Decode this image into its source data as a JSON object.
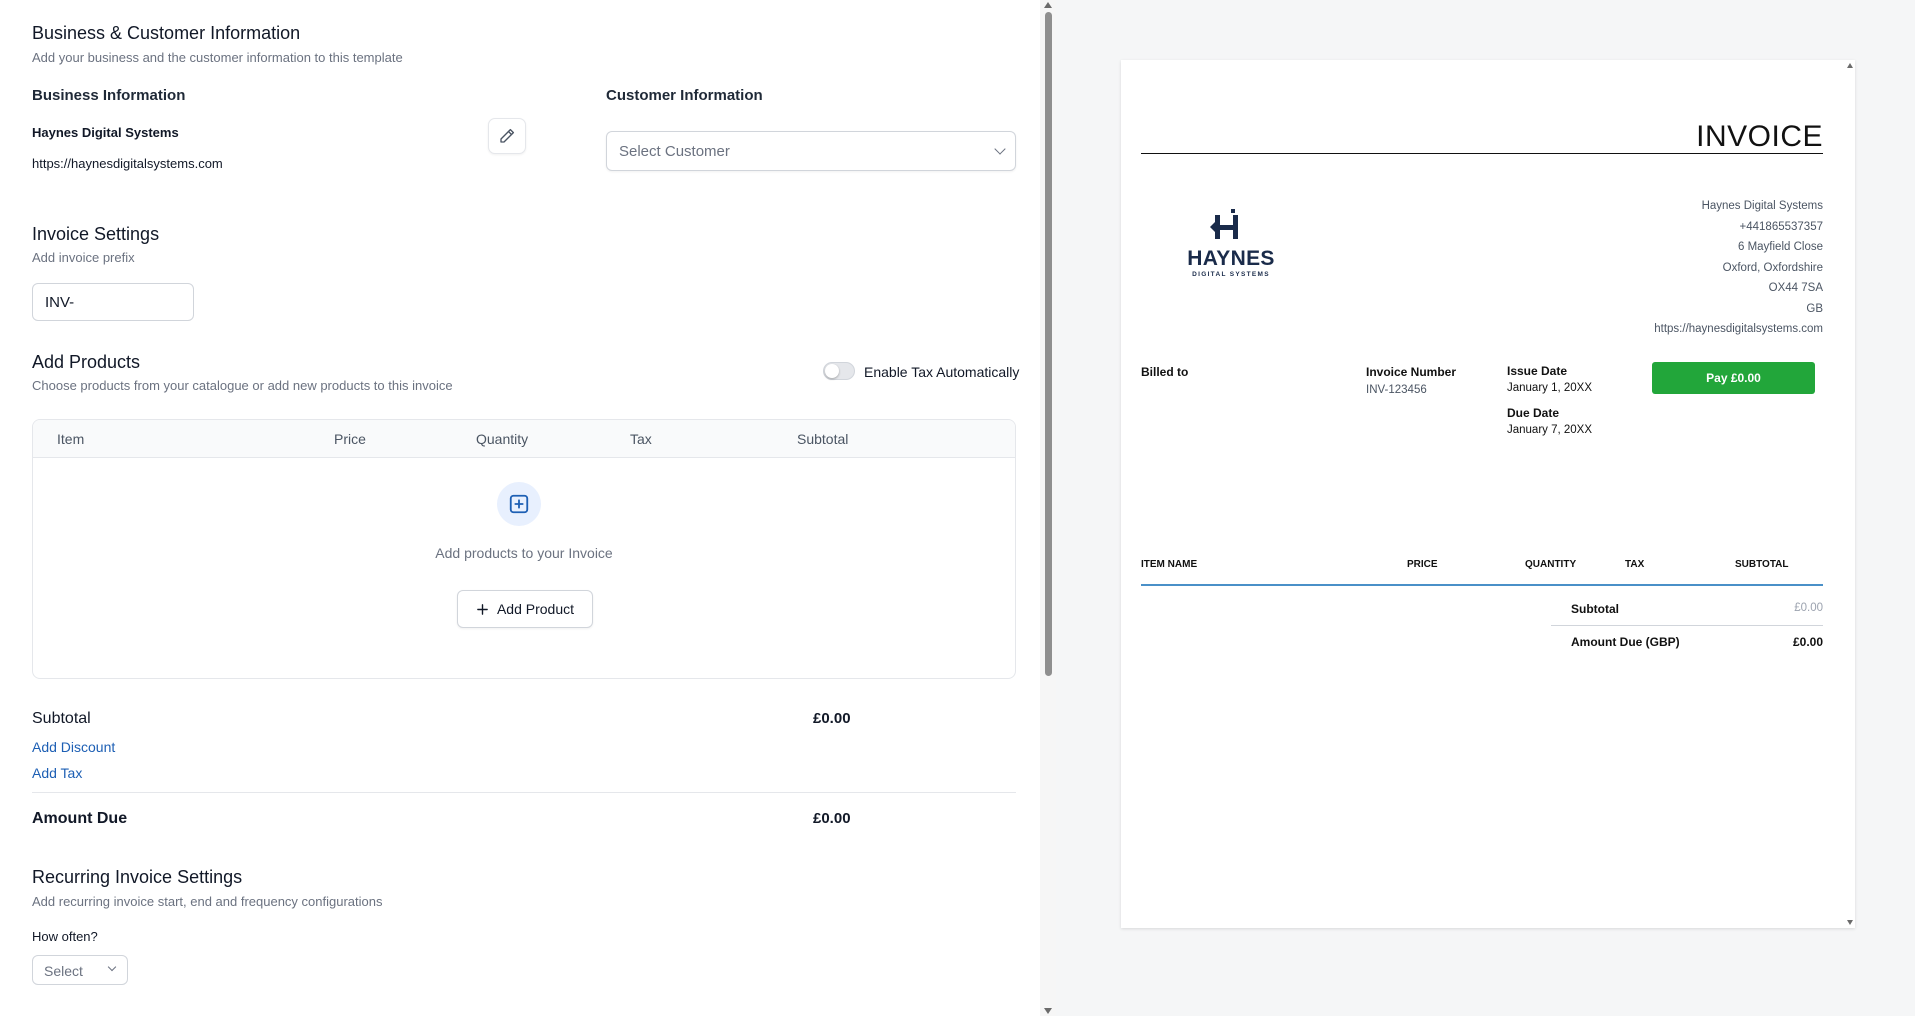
{
  "business_customer": {
    "title": "Business & Customer Information",
    "subtitle": "Add your business and the customer information to this template",
    "business_heading": "Business Information",
    "business_name": "Haynes Digital Systems",
    "business_url": "https://haynesdigitalsystems.com",
    "customer_heading": "Customer Information",
    "customer_select_placeholder": "Select Customer"
  },
  "invoice_settings": {
    "title": "Invoice Settings",
    "subtitle": "Add invoice prefix",
    "prefix_value": "INV-"
  },
  "add_products": {
    "title": "Add Products",
    "subtitle": "Choose products from your catalogue or add new products to this invoice",
    "tax_toggle_label": "Enable Tax Automatically",
    "tax_toggle_on": false,
    "columns": [
      "Item",
      "Price",
      "Quantity",
      "Tax",
      "Subtotal"
    ],
    "empty_text": "Add products to your Invoice",
    "add_button_label": "Add Product"
  },
  "totals": {
    "subtotal_label": "Subtotal",
    "subtotal_value": "£0.00",
    "add_discount_label": "Add Discount",
    "add_tax_label": "Add Tax",
    "amount_due_label": "Amount Due",
    "amount_due_value": "£0.00"
  },
  "recurring": {
    "title": "Recurring Invoice Settings",
    "subtitle": "Add recurring invoice start, end and frequency configurations",
    "how_often_label": "How often?",
    "frequency_placeholder": "Select"
  },
  "preview": {
    "title": "INVOICE",
    "logo_text": "HAYNES",
    "logo_subtext": "DIGITAL SYSTEMS",
    "from": {
      "name": "Haynes Digital Systems",
      "phone": "+441865537357",
      "street": "6 Mayfield Close",
      "city": "Oxford, Oxfordshire",
      "postcode": "OX44 7SA",
      "country": "GB",
      "url": "https://haynesdigitalsystems.com"
    },
    "billed_to_label": "Billed to",
    "invoice_number_label": "Invoice Number",
    "invoice_number": "INV-123456",
    "issue_date_label": "Issue Date",
    "issue_date": "January 1, 20XX",
    "due_date_label": "Due Date",
    "due_date": "January 7, 20XX",
    "pay_button_label": "Pay £0.00",
    "columns": [
      "ITEM NAME",
      "PRICE",
      "QUANTITY",
      "TAX",
      "SUBTOTAL"
    ],
    "subtotal_label": "Subtotal",
    "subtotal_value": "£0.00",
    "amount_due_label": "Amount Due (GBP)",
    "amount_due_value": "£0.00"
  },
  "colors": {
    "link": "#1d5fb4",
    "pay_button": "#22a63a",
    "table_rule": "#4a90c8",
    "logo": "#1a2b4a"
  }
}
